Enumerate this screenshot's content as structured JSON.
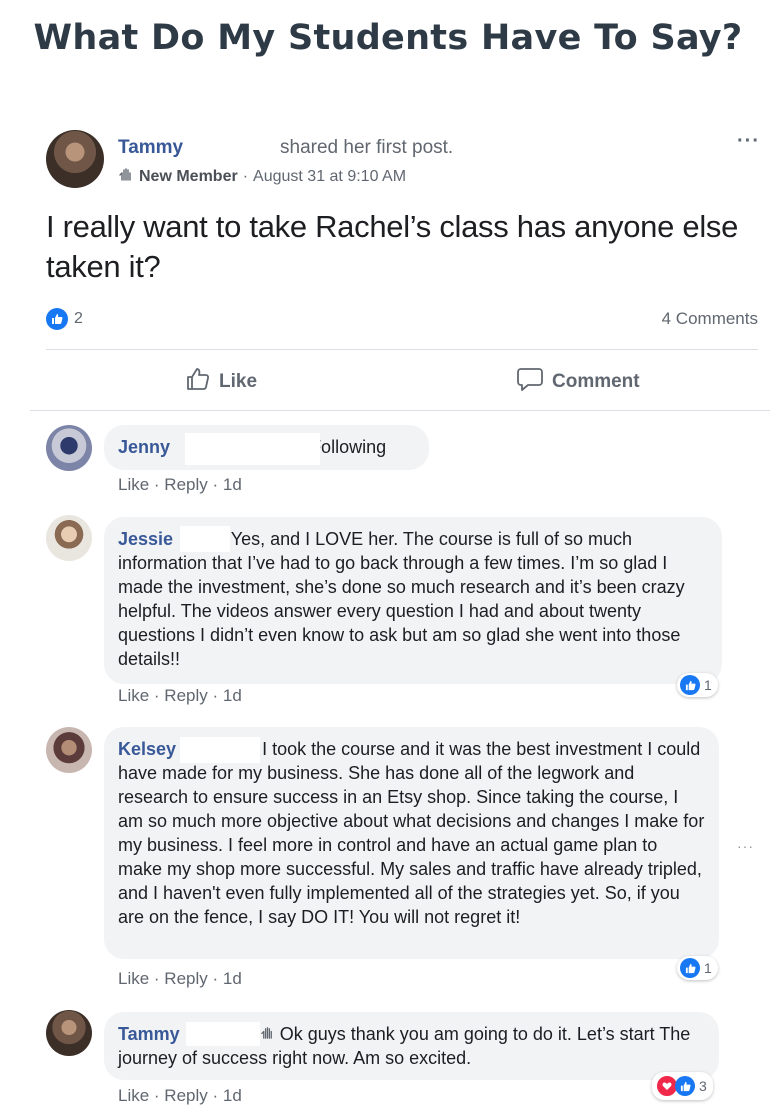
{
  "page": {
    "title": "What Do My Students Have To Say?"
  },
  "post": {
    "author": "Tammy",
    "action": "shared her first post.",
    "badge_label": "New Member",
    "separator": "·",
    "timestamp": "August 31 at 9:10 AM",
    "body": "I really want to take Rachel’s class has anyone else taken it?",
    "reaction_count": "2",
    "comments_count": "4 Comments",
    "like_label": "Like",
    "comment_label": "Comment",
    "more_label": "···"
  },
  "comments": [
    {
      "author": "Jenny",
      "text": "Following",
      "actions": "Like · Reply · 1d"
    },
    {
      "author": "Jessie",
      "text": "Yes, and I LOVE her. The course is full of so much information that I’ve had to go back through a few times. I’m so glad I made the investment, she’s done so much research and it’s been crazy helpful. The videos answer every question I had and about twenty questions I didn’t even know to ask but am so glad she went into those details!!",
      "actions": "Like · Reply · 1d",
      "reaction_count": "1"
    },
    {
      "author": "Kelsey",
      "text": "I took the course and it was the best investment I could have made for my business. She has done all of the legwork and research to ensure success in an Etsy shop. Since taking the course, I am so much more objective about what decisions and changes I make for my business. I feel more in control and have an actual game plan to make my shop more successful. My sales and traffic have already tripled, and I haven't even fully implemented all of the strategies yet. So, if you are on the fence, I say DO IT! You will not regret it!",
      "actions": "Like · Reply · 1d",
      "reaction_count": "1"
    },
    {
      "author": "Tammy",
      "text": "Ok guys thank you am going to do it. Let’s start The journey of success right now. Am so excited.",
      "actions": "Like · Reply · 1d",
      "reaction_count": "3"
    }
  ],
  "icons": {
    "like": "thumbs-up-icon",
    "comment": "speech-bubble-icon",
    "new_member": "hand-wave-icon",
    "love": "heart-icon",
    "more": "more-icon"
  },
  "colors": {
    "link": "#385898",
    "like_blue": "#1877f2",
    "love_red": "#f0284a",
    "title": "#2e3b47"
  }
}
